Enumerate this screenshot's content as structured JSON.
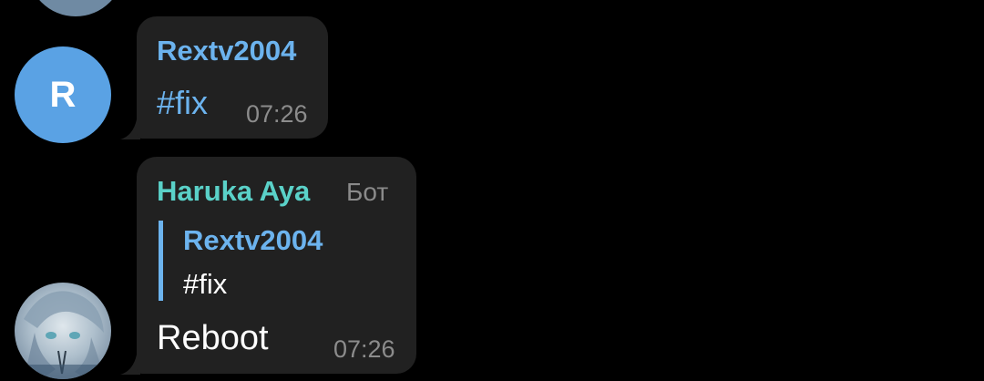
{
  "messages": [
    {
      "avatar_letter": "R",
      "sender": "Rextv2004",
      "text": "#fix",
      "time": "07:26"
    },
    {
      "sender": "Haruka Aya",
      "tag": "Бот",
      "reply": {
        "sender": "Rextv2004",
        "text": "#fix"
      },
      "text": "Reboot",
      "time": "07:26"
    }
  ],
  "colors": {
    "background": "#000000",
    "bubble": "#212121",
    "link": "#6cb3ee",
    "bot_name": "#5ad1c8",
    "avatar_r": "#5aa2e4"
  }
}
